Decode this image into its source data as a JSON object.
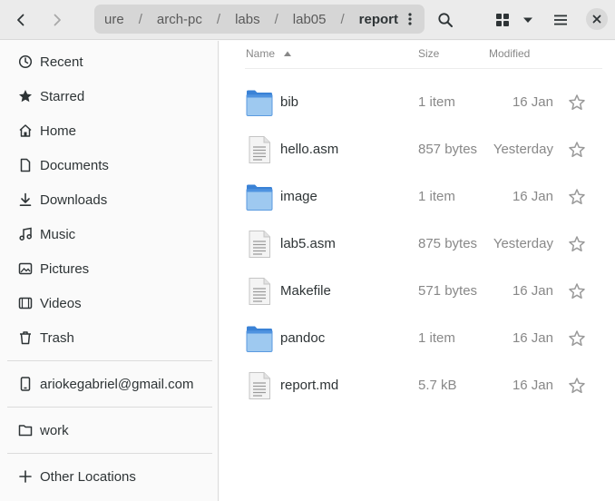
{
  "header": {
    "path": [
      "ure",
      "arch-pc",
      "labs",
      "lab05",
      "report"
    ],
    "current": "report"
  },
  "sidebar": {
    "items": [
      {
        "label": "Recent",
        "icon": "clock-icon"
      },
      {
        "label": "Starred",
        "icon": "star-icon"
      },
      {
        "label": "Home",
        "icon": "home-icon"
      },
      {
        "label": "Documents",
        "icon": "document-icon"
      },
      {
        "label": "Downloads",
        "icon": "download-icon"
      },
      {
        "label": "Music",
        "icon": "music-icon"
      },
      {
        "label": "Pictures",
        "icon": "picture-icon"
      },
      {
        "label": "Videos",
        "icon": "video-icon"
      },
      {
        "label": "Trash",
        "icon": "trash-icon"
      }
    ],
    "account": "ariokegabriel@gmail.com",
    "bookmark": "work",
    "other_locations": "Other Locations"
  },
  "columns": {
    "name": "Name",
    "size": "Size",
    "modified": "Modified"
  },
  "files": [
    {
      "name": "bib",
      "type": "folder",
      "size": "1 item",
      "modified": "16 Jan"
    },
    {
      "name": "hello.asm",
      "type": "file",
      "size": "857 bytes",
      "modified": "Yesterday"
    },
    {
      "name": "image",
      "type": "folder",
      "size": "1 item",
      "modified": "16 Jan"
    },
    {
      "name": "lab5.asm",
      "type": "file",
      "size": "875 bytes",
      "modified": "Yesterday"
    },
    {
      "name": "Makefile",
      "type": "file",
      "size": "571 bytes",
      "modified": "16 Jan"
    },
    {
      "name": "pandoc",
      "type": "folder",
      "size": "1 item",
      "modified": "16 Jan"
    },
    {
      "name": "report.md",
      "type": "file",
      "size": "5.7 kB",
      "modified": "16 Jan"
    }
  ]
}
